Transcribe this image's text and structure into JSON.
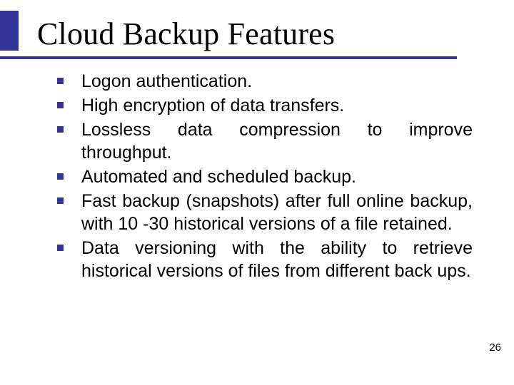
{
  "title": "Cloud Backup Features",
  "bullets": [
    "Logon authentication.",
    "High encryption of data transfers.",
    "Lossless data compression to improve throughput.",
    "Automated and scheduled backup.",
    "Fast backup (snapshots) after full online backup, with 10 -30 historical versions of a file retained.",
    "Data versioning with the ability to retrieve historical versions of files from different back ups."
  ],
  "page_number": "26"
}
